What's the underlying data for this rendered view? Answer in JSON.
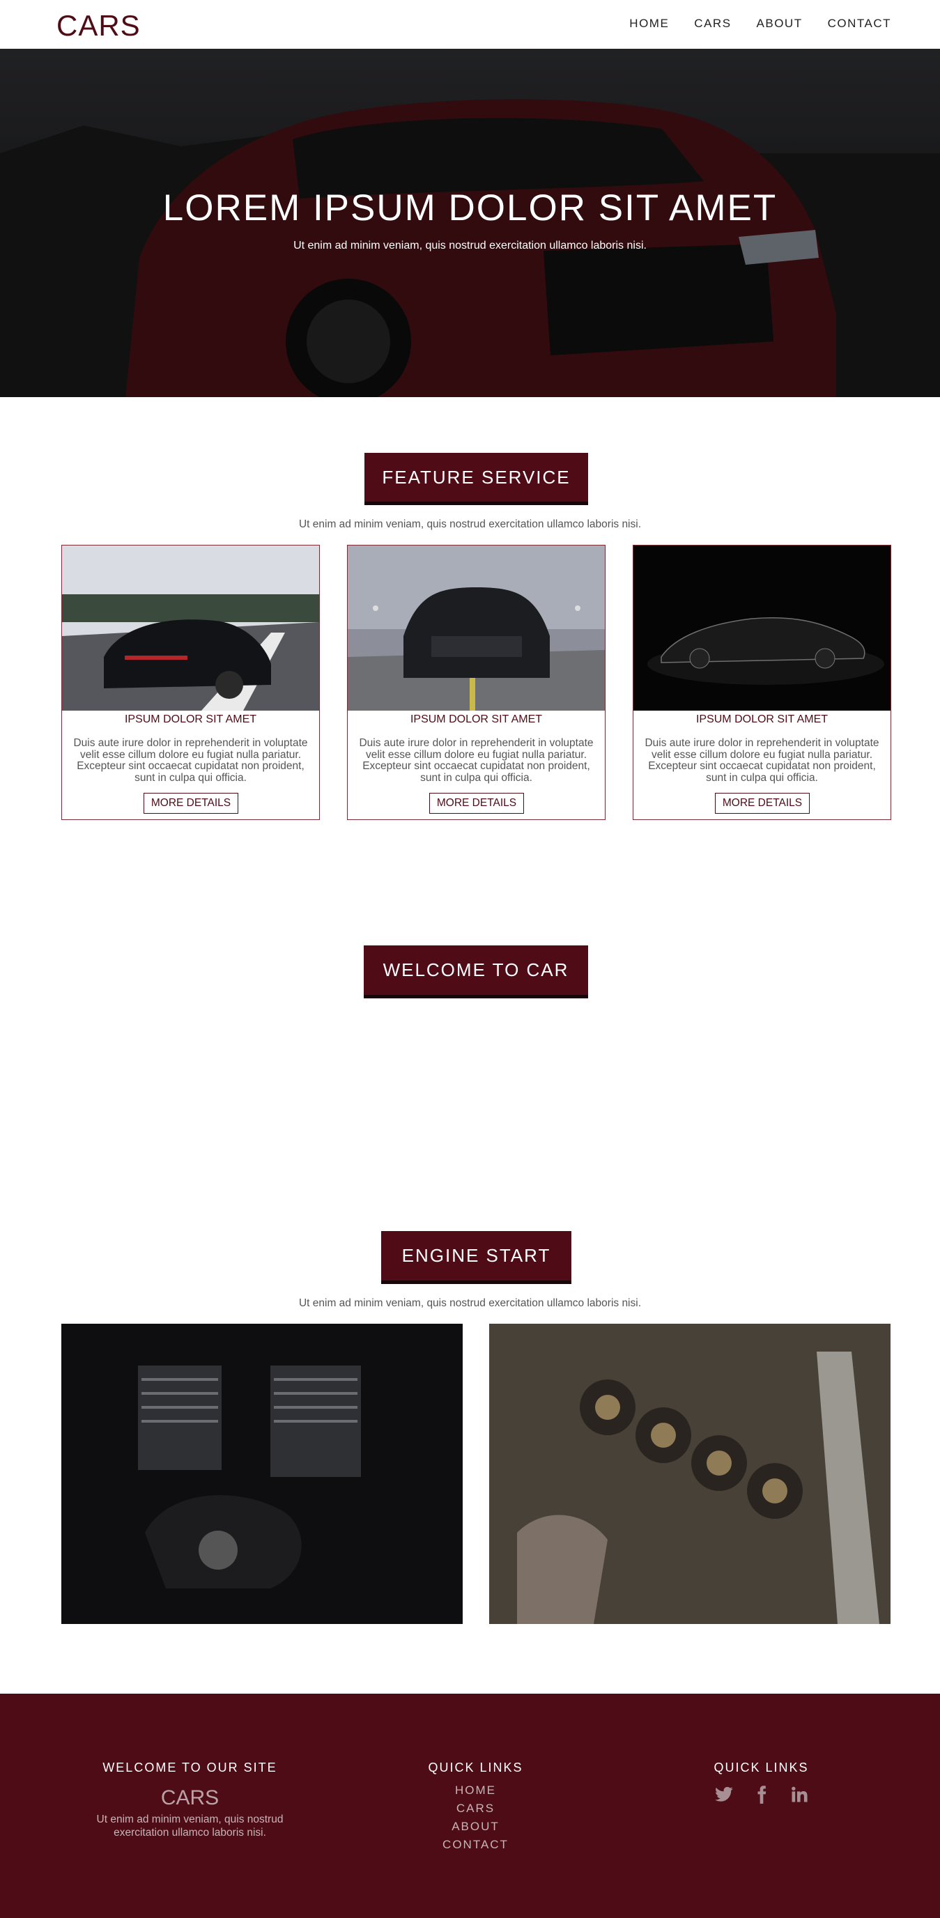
{
  "nav": {
    "brand": "CARS",
    "items": [
      "HOME",
      "CARS",
      "ABOUT",
      "CONTACT"
    ]
  },
  "hero": {
    "title": "LOREM IPSUM DOLOR SIT AMET",
    "subtitle": "Ut enim ad minim veniam, quis nostrud exercitation ullamco laboris nisi."
  },
  "features": {
    "heading": "FEATURE SERVICE",
    "subtitle": "Ut enim ad minim veniam, quis nostrud exercitation ullamco laboris nisi.",
    "cards": [
      {
        "title": "IPSUM DOLOR SIT AMET",
        "text": "Duis aute irure dolor in reprehenderit in voluptate velit esse cillum dolore eu fugiat nulla pariatur. Excepteur sint occaecat cupidatat non proident, sunt in culpa qui officia.",
        "button": "MORE DETAILS"
      },
      {
        "title": "IPSUM DOLOR SIT AMET",
        "text": "Duis aute irure dolor in reprehenderit in voluptate velit esse cillum dolore eu fugiat nulla pariatur. Excepteur sint occaecat cupidatat non proident, sunt in culpa qui officia.",
        "button": "MORE DETAILS"
      },
      {
        "title": "IPSUM DOLOR SIT AMET",
        "text": "Duis aute irure dolor in reprehenderit in voluptate velit esse cillum dolore eu fugiat nulla pariatur. Excepteur sint occaecat cupidatat non proident, sunt in culpa qui officia.",
        "button": "MORE DETAILS"
      }
    ]
  },
  "welcome": {
    "heading": "WELCOME TO CAR"
  },
  "engine": {
    "heading": "ENGINE START",
    "subtitle": "Ut enim ad minim veniam, quis nostrud exercitation ullamco laboris nisi."
  },
  "footer": {
    "col1": {
      "heading": "WELCOME TO OUR SITE",
      "brand": "CARS",
      "text": "Ut enim ad minim veniam, quis nostrud exercitation ullamco laboris nisi."
    },
    "col2": {
      "heading": "QUICK LINKS",
      "links": [
        "HOME",
        "CARS",
        "ABOUT",
        "CONTACT"
      ]
    },
    "col3": {
      "heading": "QUICK LINKS",
      "social": [
        "twitter-icon",
        "facebook-icon",
        "linkedin-icon"
      ]
    }
  },
  "colors": {
    "accent": "#4f0c17",
    "footer_bg": "#4d0c16"
  }
}
